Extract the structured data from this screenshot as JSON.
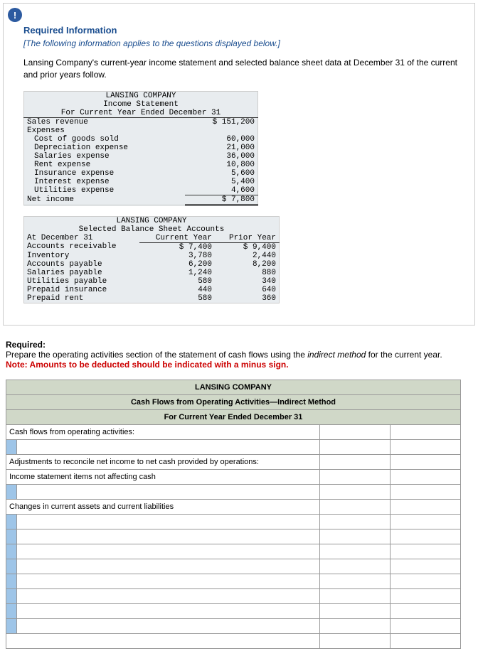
{
  "header": {
    "required_info": "Required Information",
    "italic_note": "[The following information applies to the questions displayed below.]",
    "description": "Lansing Company's current-year income statement and selected balance sheet data at December 31 of the current and prior years follow."
  },
  "income_statement": {
    "title": "LANSING COMPANY",
    "subtitle": "Income Statement",
    "period": "For Current Year Ended December 31",
    "sales_revenue_label": "Sales revenue",
    "sales_revenue": "$ 151,200",
    "expenses_label": "Expenses",
    "rows": [
      {
        "label": "Cost of goods sold",
        "value": "60,000"
      },
      {
        "label": "Depreciation expense",
        "value": "21,000"
      },
      {
        "label": "Salaries expense",
        "value": "36,000"
      },
      {
        "label": "Rent expense",
        "value": "10,800"
      },
      {
        "label": "Insurance expense",
        "value": "5,600"
      },
      {
        "label": "Interest expense",
        "value": "5,400"
      },
      {
        "label": "Utilities expense",
        "value": "4,600"
      }
    ],
    "net_income_label": "Net income",
    "net_income": "$ 7,800"
  },
  "balance_sheet": {
    "title": "LANSING COMPANY",
    "subtitle": "Selected Balance Sheet Accounts",
    "date_label": "At December 31",
    "col1": "Current Year",
    "col2": "Prior Year",
    "rows": [
      {
        "label": "Accounts receivable",
        "cy": "$ 7,400",
        "py": "$ 9,400"
      },
      {
        "label": "Inventory",
        "cy": "3,780",
        "py": "2,440"
      },
      {
        "label": "Accounts payable",
        "cy": "6,200",
        "py": "8,200"
      },
      {
        "label": "Salaries payable",
        "cy": "1,240",
        "py": "880"
      },
      {
        "label": "Utilities payable",
        "cy": "580",
        "py": "340"
      },
      {
        "label": "Prepaid insurance",
        "cy": "440",
        "py": "640"
      },
      {
        "label": "Prepaid rent",
        "cy": "580",
        "py": "360"
      }
    ]
  },
  "required": {
    "label": "Required:",
    "body_pre": "Prepare the operating activities section of the statement of cash flows using the ",
    "body_italic": "indirect method",
    "body_post": " for the current year.",
    "note": "Note: Amounts to be deducted should be indicated with a minus sign."
  },
  "cashflow": {
    "company": "LANSING COMPANY",
    "heading": "Cash Flows from Operating Activities—Indirect Method",
    "period": "For Current Year Ended December 31",
    "row1": "Cash flows from operating activities:",
    "row_adj": "Adjustments to reconcile net income to net cash provided by operations:",
    "row_is": "Income statement items not affecting cash",
    "row_changes": "Changes in current assets and current liabilities"
  }
}
